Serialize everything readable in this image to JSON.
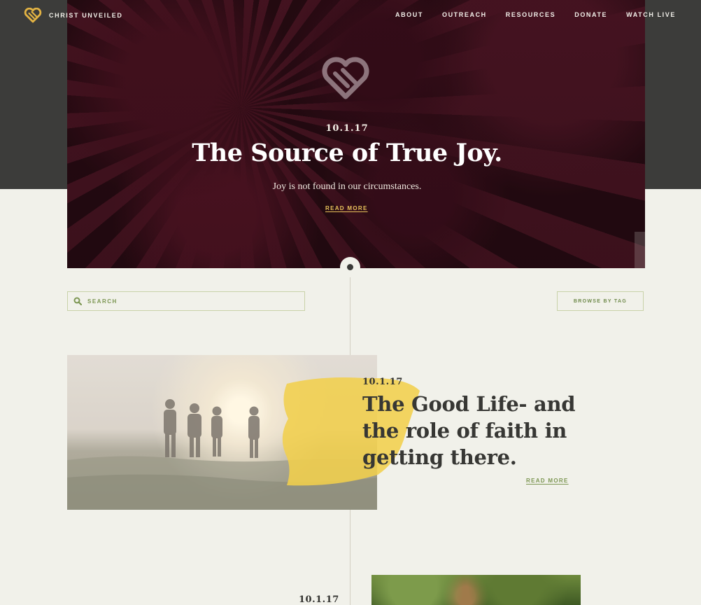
{
  "brand": {
    "name": "CHRIST UNVEILED",
    "logo_icon": "heart-logo-icon",
    "accent": "#e3b343"
  },
  "nav": {
    "items": [
      "ABOUT",
      "OUTREACH",
      "RESOURCES",
      "DONATE",
      "WATCH LIVE"
    ]
  },
  "hero": {
    "date": "10.1.17",
    "title": "The Source of True Joy.",
    "subtitle": "Joy is not found in our circumstances.",
    "read_more": "READ MORE",
    "prev_icon": "arrow-left-icon",
    "next_icon": "arrow-right-icon"
  },
  "search": {
    "placeholder": "SEARCH",
    "icon": "search-icon"
  },
  "browse": {
    "label": "BROWSE BY TAG"
  },
  "posts": [
    {
      "date": "10.1.17",
      "title": "The Good Life- and the role of faith in getting there.",
      "read_more": "READ MORE"
    },
    {
      "date": "10.1.17"
    }
  ],
  "colors": {
    "dark_band": "#3c3c3a",
    "green": "#7c9652",
    "gold": "#e8c25b",
    "background": "#f1f1ea"
  }
}
